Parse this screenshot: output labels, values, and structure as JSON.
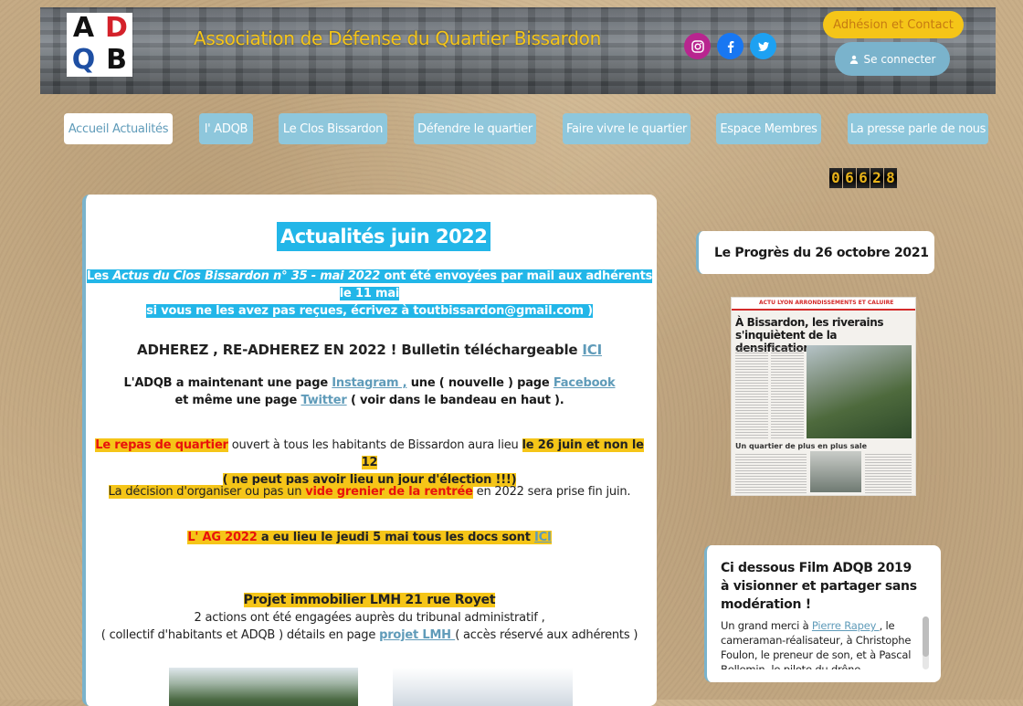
{
  "header": {
    "logo_letters": [
      "A",
      "D",
      "Q",
      "B"
    ],
    "title": "Association  de Défense du Quartier  Bissardon",
    "social": [
      {
        "name": "instagram-icon",
        "color": "#b8258f"
      },
      {
        "name": "facebook-icon",
        "color": "#1877f2"
      },
      {
        "name": "twitter-icon",
        "color": "#1da1f2"
      }
    ],
    "adhesion_label": "Adhésion et Contact",
    "login_label": "Se connecter"
  },
  "nav": {
    "items": [
      "Accueil Actualités",
      "l' ADQB",
      "Le Clos Bissardon",
      "Défendre le quartier",
      "Faire vivre le quartier",
      "Espace Membres",
      "La presse parle de nous"
    ],
    "active_index": 0
  },
  "counter": [
    "0",
    "6",
    "6",
    "2",
    "8"
  ],
  "main": {
    "title": "Actualités juin 2022",
    "p1_a": "Les ",
    "p1_b": "Actus du Clos Bissardon n° 35 - mai 2022",
    "p1_c": " ont été envoyées par mail aux adhérents le 11 mai",
    "p1_d": "si vous ne les avez pas reçues, écrivez à toutbissardon@gmail.com )",
    "adherez": "ADHEREZ , RE-ADHEREZ EN 2022 !    Bulletin téléchargeable ",
    "ici": "ICI",
    "social_a": "L'ADQB a maintenant une page ",
    "instagram": "Instagram ,",
    "social_b": " une ( nouvelle ) page ",
    "facebook": "Facebook",
    "social_c": "et même une page ",
    "twitter": "Twitter",
    "social_d": " ( voir dans le bandeau en haut ).",
    "repas_a": "Le repas de quartier",
    "repas_b": " ouvert à tous les  habitants de Bissardon aura lieu ",
    "repas_c": "le 26 juin et non le 12",
    "repas_d": "( ne peut pas avoir lieu un jour d'élection !!!)",
    "vide_a": "La décision d'organiser ou pas un ",
    "vide_b": "vide grenier de la rentrée",
    "vide_c": " en 2022 sera prise fin juin.",
    "ag_a": "L' AG 2022",
    "ag_b": " a eu lieu le jeudi 5 mai   tous les docs sont ",
    "ag_ici": "ICI",
    "projet_title": "Projet immobilier LMH 21 rue Royet",
    "projet_1": "2 actions  ont été engagées auprès du tribunal administratif ,",
    "projet_2": "( collectif d'habitants et ADQB ) détails en page ",
    "projet_link": "projet LMH ",
    "projet_3": "( accès réservé aux adhérents )"
  },
  "sidebar": {
    "progres_title": "Le Progrès du 26 octobre 2021",
    "clip_band": "ACTU  LYON ARRONDISSEMENTS ET CALUIRE",
    "clip_headline": "À Bissardon, les riverains s'inquiètent de la densification",
    "clip_sub": "Un quartier de plus en plus sale",
    "film_title": "Ci dessous Film ADQB 2019  à visionner et partager sans modération !",
    "film_a": "Un grand merci  à ",
    "film_link": "Pierre Rapey ",
    "film_b": ", le cameraman-réalisateur, à Christophe Foulon, le preneur de son, et  à Pascal Bellemin, le pilote du drône."
  },
  "colors": {
    "accent_blue": "#22b6e8",
    "nav_blue": "#8ec7dc",
    "yellow": "#f5c518",
    "red": "#e8120c"
  }
}
